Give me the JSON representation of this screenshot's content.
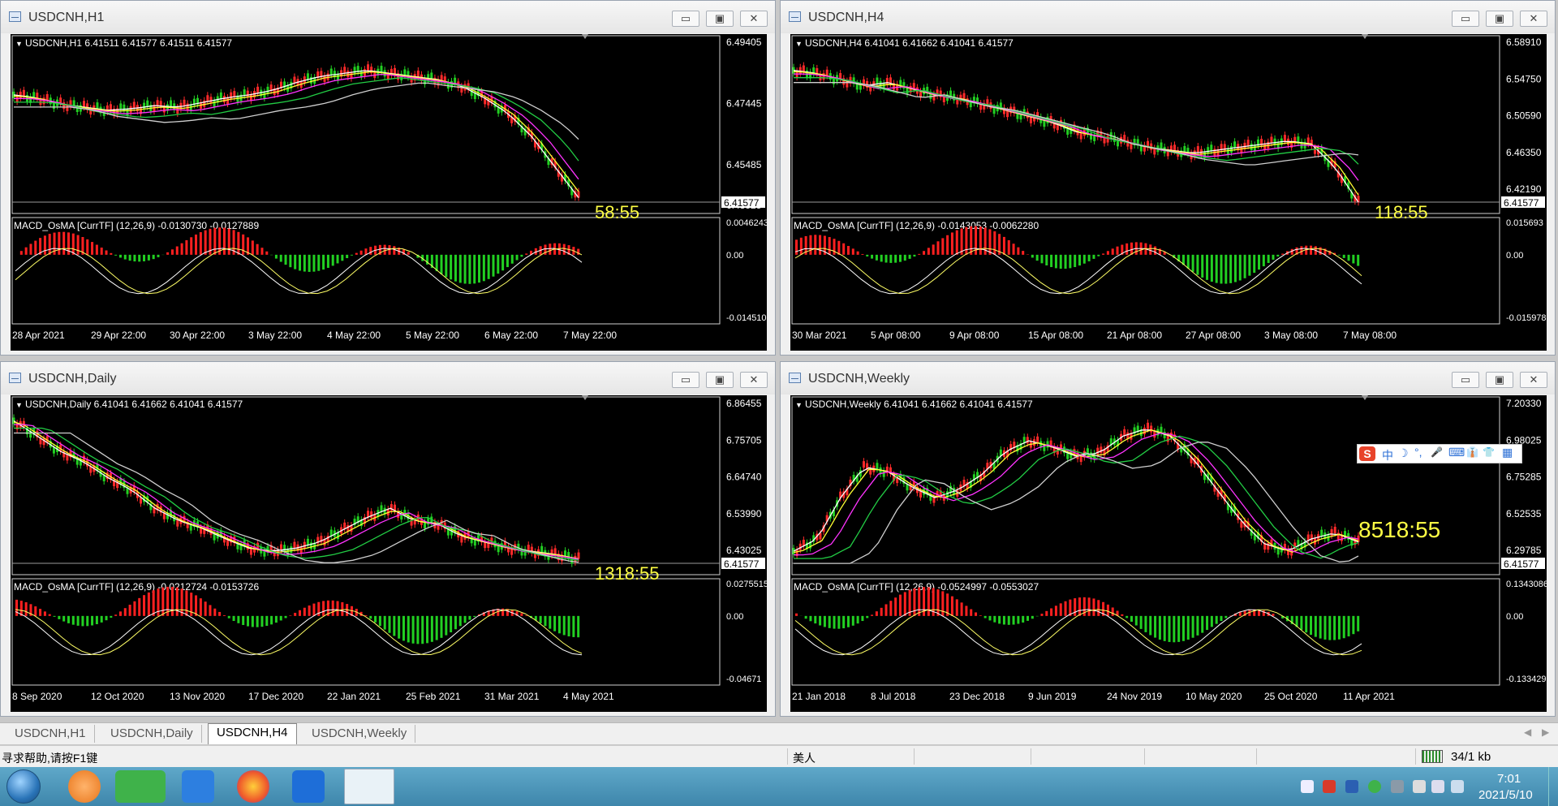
{
  "windows": [
    {
      "title": "USDCNH,H1",
      "header": "USDCNH,H1  6.41511 6.41577 6.41511 6.41577",
      "price_labels": [
        "6.49405",
        "6.47445",
        "6.45485",
        "6.43525"
      ],
      "price_current": "6.41577",
      "timer": "58:55",
      "indicator": "MACD_OsMA [CurrTF] (12,26,9) -0.0130730 -0.0127889",
      "macd_labels": [
        "0.0046243",
        "0.00",
        "-0.0145102"
      ],
      "time_labels": [
        "28 Apr 2021",
        "29 Apr 22:00",
        "30 Apr 22:00",
        "3 May 22:00",
        "4 May 22:00",
        "5 May 22:00",
        "6 May 22:00",
        "7 May 22:00"
      ]
    },
    {
      "title": "USDCNH,H4",
      "header": "USDCNH,H4  6.41041 6.41662 6.41041 6.41577",
      "price_labels": [
        "6.58910",
        "6.54750",
        "6.50590",
        "6.46350",
        "6.42190"
      ],
      "price_current": "6.41577",
      "timer": "118:55",
      "indicator": "MACD_OsMA [CurrTF] (12,26,9) -0.0143053 -0.0062280",
      "macd_labels": [
        "0.015693",
        "0.00",
        "-0.0159788"
      ],
      "time_labels": [
        "30 Mar 2021",
        "5 Apr 08:00",
        "9 Apr 08:00",
        "15 Apr 08:00",
        "21 Apr 08:00",
        "27 Apr 08:00",
        "3 May 08:00",
        "7 May 08:00"
      ]
    },
    {
      "title": "USDCNH,Daily",
      "header": "USDCNH,Daily  6.41041 6.41662 6.41041 6.41577",
      "price_labels": [
        "6.86455",
        "6.75705",
        "6.64740",
        "6.53990",
        "6.43025"
      ],
      "price_current": "6.41577",
      "timer": "1318:55",
      "indicator": "MACD_OsMA [CurrTF] (12,26,9) -0.0212724 -0.0153726",
      "macd_labels": [
        "0.0275515",
        "0.00",
        "-0.04671"
      ],
      "time_labels": [
        "8 Sep 2020",
        "12 Oct 2020",
        "13 Nov 2020",
        "17 Dec 2020",
        "22 Jan 2021",
        "25 Feb 2021",
        "31 Mar 2021",
        "4 May 2021"
      ]
    },
    {
      "title": "USDCNH,Weekly",
      "header": "USDCNH,Weekly  6.41041 6.41662 6.41041 6.41577",
      "price_labels": [
        "7.20330",
        "6.98025",
        "6.75285",
        "6.52535",
        "6.29785"
      ],
      "price_current": "6.41577",
      "timer": "8518:55",
      "indicator": "MACD_OsMA [CurrTF] (12,26,9) -0.0524997 -0.0553027",
      "macd_labels": [
        "0.1343086",
        "0.00",
        "-0.1334299"
      ],
      "time_labels": [
        "21 Jan 2018",
        "8 Jul 2018",
        "23 Dec 2018",
        "9 Jun 2019",
        "24 Nov 2019",
        "10 May 2020",
        "25 Oct 2020",
        "11 Apr 2021"
      ]
    }
  ],
  "tabs": [
    "USDCNH,H1",
    "USDCNH,Daily",
    "USDCNH,H4",
    "USDCNH,Weekly"
  ],
  "active_tab": "USDCNH,H4",
  "status": {
    "help": "寻求帮助,请按F1键",
    "profile": "美人",
    "traffic": "34/1 kb"
  },
  "ime": {
    "glyphs": [
      "中",
      "☽",
      "°,",
      "🎤",
      "⌨",
      "👔",
      "👕",
      "▦"
    ]
  },
  "clock": {
    "time": "7:01",
    "date": "2021/5/10"
  },
  "window_buttons": {
    "minimize": "▭",
    "maximize": "▣",
    "close": "✕"
  }
}
